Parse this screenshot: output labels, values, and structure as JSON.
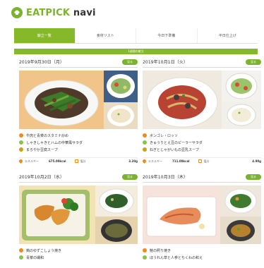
{
  "brand": {
    "name_part1": "EATPICK",
    "name_part2": " navi"
  },
  "tabs": [
    {
      "label": "献立一覧",
      "active": true
    },
    {
      "label": "食材リスト",
      "active": false
    },
    {
      "label": "今日下準備",
      "active": false
    },
    {
      "label": "平日仕上げ",
      "active": false
    }
  ],
  "banner": {
    "label": "1週間の献立"
  },
  "cards": [
    {
      "date": "2019年9月30日（月）",
      "button": "見る",
      "menu": [
        {
          "dot": "orange",
          "label": "牛肉と青菜のスタミナ炒め"
        },
        {
          "dot": "green",
          "label": "しゃきしゃきとハムの中華風サラダ"
        },
        {
          "dot": "olive",
          "label": "まろやか豆腐スープ"
        }
      ],
      "energy_label": "エネルギー",
      "energy_value": "675.00kcal",
      "salt_label": "塩分",
      "salt_value": "3.20g"
    },
    {
      "date": "2019年10月1日（火）",
      "button": "見る",
      "menu": [
        {
          "dot": "orange",
          "label": "ボンゴレ・ロッソ"
        },
        {
          "dot": "green",
          "label": "きゅうりとえ豆のピーラーサラダ"
        },
        {
          "dot": "olive",
          "label": "ねぎとじゃがいもの豆乳スープ"
        }
      ],
      "energy_label": "エネルギー",
      "energy_value": "711.00kcal",
      "salt_label": "塩分",
      "salt_value": "4.90g"
    },
    {
      "date": "2019年10月2日（水）",
      "button": "見る",
      "menu": [
        {
          "dot": "orange",
          "label": "鶏のゆずこしょう焼き"
        },
        {
          "dot": "green",
          "label": "青菜の磯和"
        }
      ]
    },
    {
      "date": "2019年10月3日（木）",
      "button": "見る",
      "menu": [
        {
          "dot": "orange",
          "label": "鮭の照り焼き"
        },
        {
          "dot": "green",
          "label": "ほうれん草と人参とちくわの和え"
        }
      ]
    }
  ],
  "icons": {
    "logo": "chef-hat-icon",
    "energy": "flame-icon",
    "salt": "salt-shaker-icon"
  },
  "colors": {
    "brand_green": "#86b92a",
    "accent_orange": "#f08a1d"
  }
}
